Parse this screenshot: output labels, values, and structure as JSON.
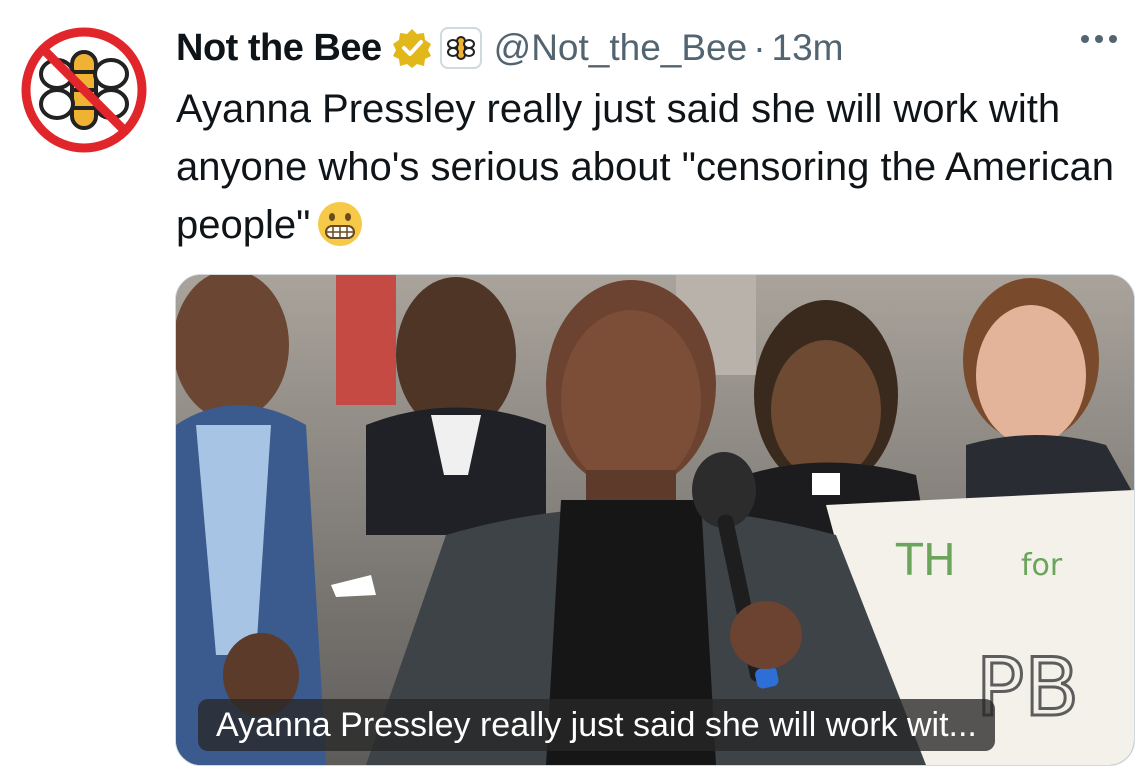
{
  "author": {
    "display_name": "Not the Bee",
    "handle": "@Not_the_Bee",
    "separator": "·",
    "time": "13m"
  },
  "icons": {
    "avatar": "no-bee-logo-icon",
    "verified": "gold-verified-badge-icon",
    "affiliate": "bee-logo-icon",
    "more": "more-options-icon",
    "emoji": "grimacing-face-emoji"
  },
  "colors": {
    "verified_gold": "#e2b719",
    "no_sign_red": "#e0262a",
    "bee_yellow": "#f0b233",
    "secondary_text": "#536471"
  },
  "tweet": {
    "text": "Ayanna Pressley really just said she will work with anyone who's serious about \"censoring the American people\""
  },
  "media": {
    "caption": "Ayanna Pressley really just said she will work wit...",
    "sign_text_1": "TH",
    "sign_text_2": "for",
    "sign_text_3": "PB"
  }
}
